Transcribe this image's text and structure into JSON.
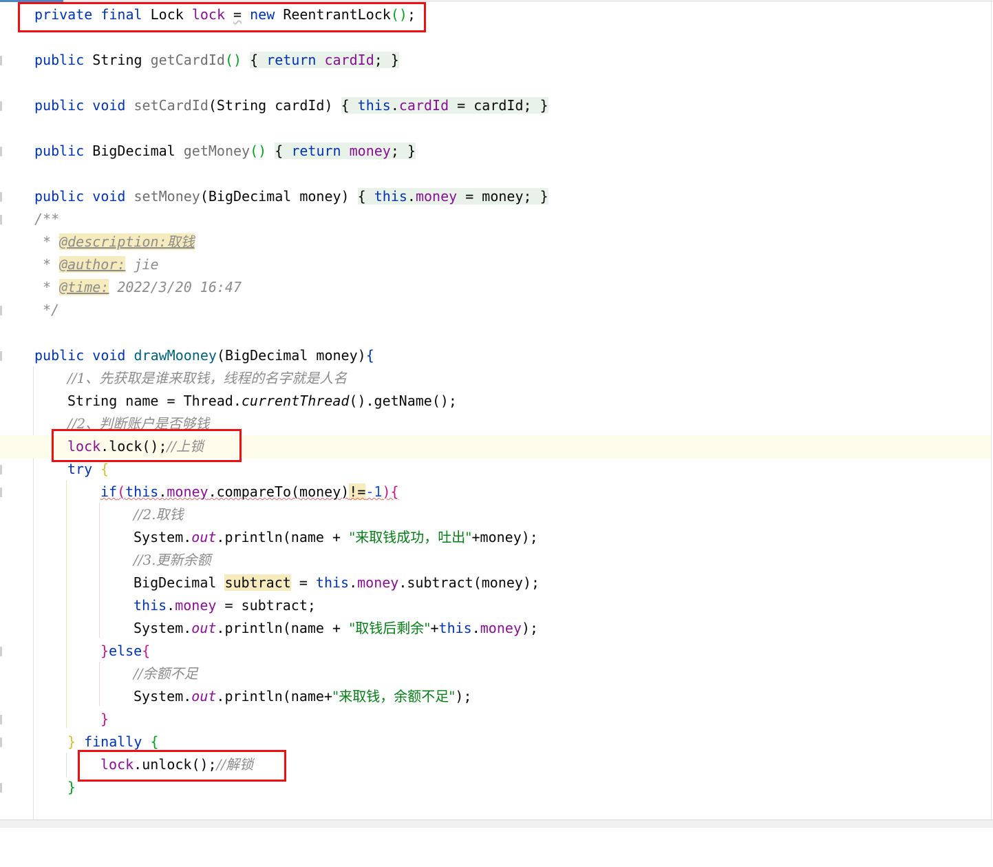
{
  "editor": {
    "language": "java",
    "highlighted_line": "lock.lock();//上锁",
    "lines": {
      "l1": {
        "a": "private",
        "b": "final",
        "c": "Lock",
        "d": "lock",
        "e": "=",
        "f": "new",
        "g": "ReentrantLock",
        "h": "()",
        ";": ";"
      },
      "l2": {
        "a": "public",
        "b": "String",
        "c": "getCardId",
        "d": "()",
        "e": "{",
        "f": "return",
        "g": "cardId",
        "h": ";",
        "i": "}"
      },
      "l3": {
        "a": "public",
        "b": "void",
        "c": "setCardId",
        "d": "(String cardId)",
        "e": "{",
        "f": "this",
        "g": ".",
        "h": "cardId",
        "i": "= cardId;",
        "j": "}"
      },
      "l4": {
        "a": "public",
        "b": "BigDecimal",
        "c": "getMoney",
        "d": "()",
        "e": "{",
        "f": "return",
        "g": "money",
        "h": ";",
        "i": "}"
      },
      "l5": {
        "a": "public",
        "b": "void",
        "c": "setMoney",
        "d": "(BigDecimal money)",
        "e": "{",
        "f": "this",
        "g": ".",
        "h": "money",
        "i": "= money;",
        "j": "}"
      },
      "l6": {
        "a": "/**"
      },
      "l7": {
        "a": "*",
        "b": "@description:",
        "c": "取钱"
      },
      "l8": {
        "a": "*",
        "b": "@author:",
        "c": "jie"
      },
      "l9": {
        "a": "*",
        "b": "@time:",
        "c": "2022/3/20 16:47"
      },
      "l10": {
        "a": "*/"
      },
      "l11": {
        "a": "public",
        "b": "void",
        "c": "drawMooney",
        "d": "(BigDecimal money)",
        "e": "{"
      },
      "l12": {
        "a": "//1、先获取是谁来取钱，线程的名字就是人名"
      },
      "l13": {
        "a": "String name = Thread.",
        "b": "currentThread",
        "c": "().getName();"
      },
      "l14": {
        "a": "//2、判断账户是否够钱"
      },
      "l15": {
        "a": "lock",
        "b": ".lock();",
        "c": "//上锁"
      },
      "l16": {
        "a": "try",
        "b": "{"
      },
      "l17": {
        "a": "if",
        "b": "(",
        "c": "this",
        "d": ".",
        "e": "money",
        "f": ".compareTo(money)",
        "g": "!=",
        "h": "-1",
        "i": "){"
      },
      "l18": {
        "a": "//2.取钱"
      },
      "l19": {
        "a": "System.",
        "b": "out",
        "c": ".println(name + ",
        "d": "\"来取钱成功，吐出\"",
        "e": "+money);"
      },
      "l20": {
        "a": "//3.更新余额"
      },
      "l21": {
        "a": "BigDecimal ",
        "b": "subtract",
        "c": " = ",
        "d": "this",
        "e": ".",
        "f": "money",
        "g": ".subtract(money);"
      },
      "l22": {
        "a": "this",
        "b": ".",
        "c": "money",
        "d": " = subtract;"
      },
      "l23": {
        "a": "System.",
        "b": "out",
        "c": ".println(name + ",
        "d": "\"取钱后剩余\"",
        "e": "+",
        "f": "this",
        "g": ".",
        "h": "money",
        "i": ");"
      },
      "l24": {
        "a": "}",
        "b": "else",
        "c": "{"
      },
      "l25": {
        "a": "//余额不足"
      },
      "l26": {
        "a": "System.",
        "b": "out",
        "c": ".println(name+",
        "d": "\"来取钱，余额不足\"",
        "e": ");"
      },
      "l27": {
        "a": "}"
      },
      "l28": {
        "a": "}",
        "b": "finally",
        "c": "{"
      },
      "l29": {
        "a": "lock",
        "b": ".unlock();",
        "c": "//解锁"
      },
      "l30": {
        "a": "}"
      }
    }
  },
  "annotations": {
    "box_color": "#ee0f12",
    "boxes": [
      "lock-field-declaration",
      "lock-call",
      "unlock-call"
    ]
  }
}
